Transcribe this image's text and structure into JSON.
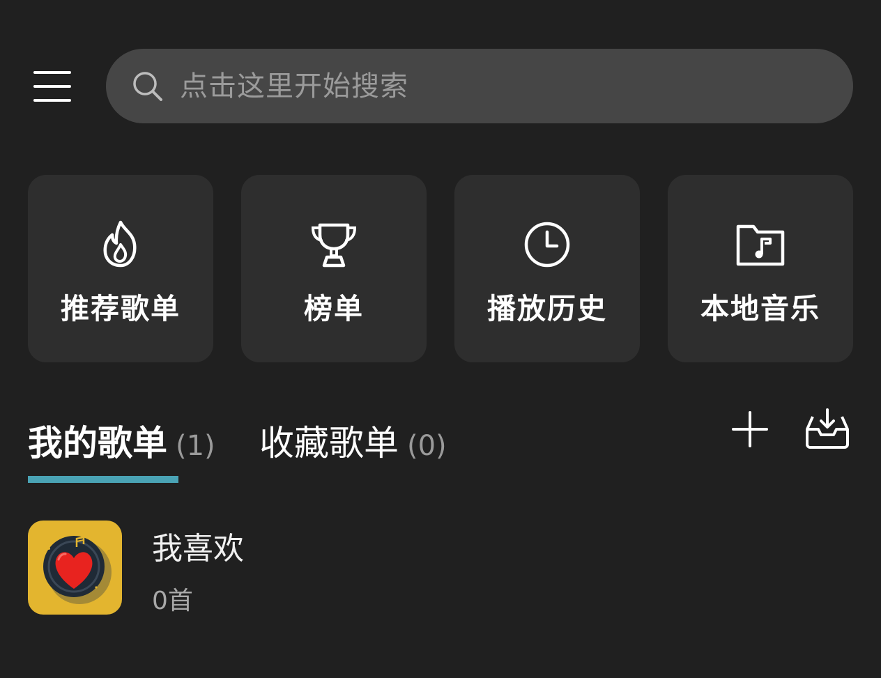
{
  "header": {
    "menu_icon": "hamburger-menu-icon",
    "search": {
      "placeholder": "点击这里开始搜索",
      "value": "",
      "icon": "search-icon"
    }
  },
  "quick_actions": [
    {
      "label": "推荐歌单",
      "icon": "flame-icon"
    },
    {
      "label": "榜单",
      "icon": "trophy-icon"
    },
    {
      "label": "播放历史",
      "icon": "clock-icon"
    },
    {
      "label": "本地音乐",
      "icon": "music-folder-icon"
    }
  ],
  "tabs": [
    {
      "label": "我的歌单",
      "count": "(1)",
      "active": true
    },
    {
      "label": "收藏歌单",
      "count": "(0)",
      "active": false
    }
  ],
  "toolbar": {
    "add_icon": "plus-icon",
    "import_icon": "inbox-download-icon"
  },
  "playlists": [
    {
      "name": "我喜欢",
      "count": "0首",
      "cover_icon": "heart-record-icon"
    }
  ],
  "colors": {
    "background": "#202020",
    "search_bg": "#464646",
    "tile_bg": "#2e2e2e",
    "tab_indicator": "#4aa3b5",
    "cover_bg": "#e3b52f",
    "heart": "#e8231f"
  }
}
